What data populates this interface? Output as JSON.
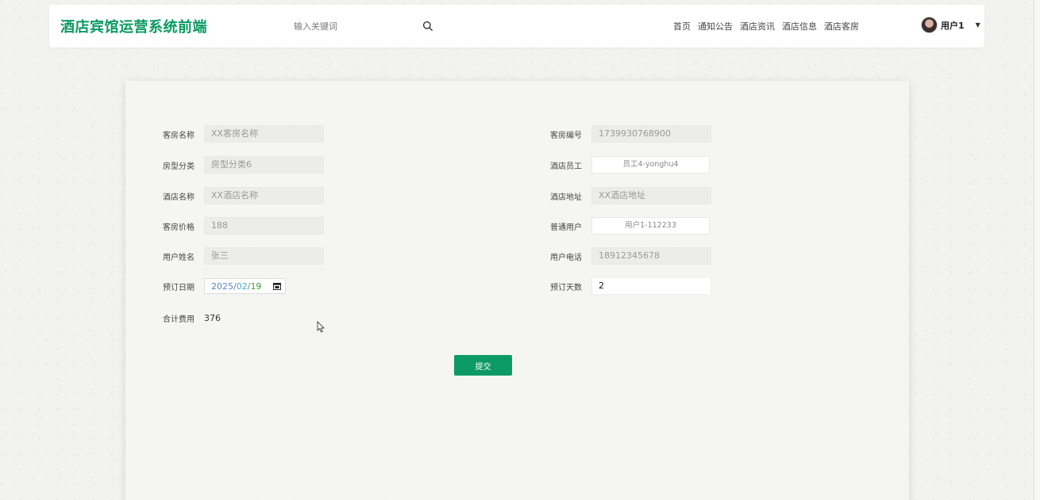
{
  "header": {
    "brand": "酒店宾馆运营系统前端",
    "search_placeholder": "输入关键词",
    "nav": [
      "首页",
      "通知公告",
      "酒店资讯",
      "酒店信息",
      "酒店客房"
    ],
    "user_name": "用户1"
  },
  "form": {
    "room_name": {
      "label": "客房名称",
      "value": "XX客房名称"
    },
    "room_no": {
      "label": "客房编号",
      "value": "1739930768900"
    },
    "room_type": {
      "label": "房型分类",
      "value": "房型分类6"
    },
    "staff": {
      "label": "酒店员工",
      "value": "员工4-yonghu4"
    },
    "hotel_name": {
      "label": "酒店名称",
      "value": "XX酒店名称"
    },
    "hotel_addr": {
      "label": "酒店地址",
      "value": "XX酒店地址"
    },
    "price": {
      "label": "客房价格",
      "value": "188"
    },
    "user": {
      "label": "普通用户",
      "value": "用户1-112233"
    },
    "user_name": {
      "label": "用户姓名",
      "value": "张三"
    },
    "phone": {
      "label": "用户电话",
      "value": "18912345678"
    },
    "date": {
      "label": "预订日期",
      "year": "2025",
      "month": "02",
      "day": "19"
    },
    "days": {
      "label": "预订天数",
      "value": "2"
    },
    "total": {
      "label": "合计费用",
      "value": "376"
    },
    "submit": "提交"
  },
  "colors": {
    "brand": "#0a9a62",
    "button": "#0b9a66"
  }
}
